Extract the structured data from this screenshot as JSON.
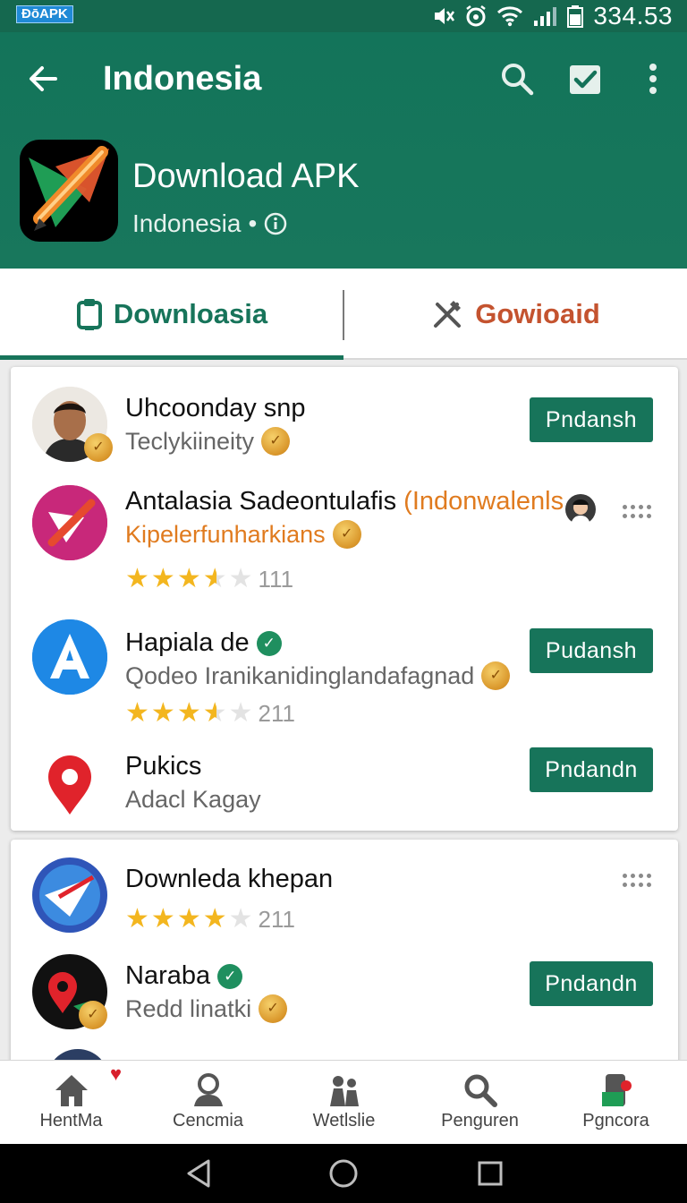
{
  "status_bar": {
    "badge": "ÐōAPK",
    "time": "334.53"
  },
  "header": {
    "title": "Indonesia",
    "app_name": "Download APK",
    "app_subtitle": "Indonesia",
    "app_subtitle_sep": "•"
  },
  "tabs": [
    {
      "label": "Downloasia",
      "active": true
    },
    {
      "label": "Gowioaid",
      "active": false
    }
  ],
  "list": [
    {
      "title": "Uhcoonday snp",
      "subtitle": "Teclykiineity",
      "button": "Pndansh"
    },
    {
      "title": "Antalasia Sadeontulafis",
      "title_accent": "(Indonwalenls",
      "subtitle": "Kipelerfunharkians",
      "rating": 3.5,
      "rating_count": "111"
    },
    {
      "title": "Hapiala de",
      "subtitle": "Qodeo Iranikanidinglandafagnad",
      "rating": 3.5,
      "rating_count": "211",
      "button": "Pudansh"
    },
    {
      "title": "Pukics",
      "subtitle": "Adacl Kagay",
      "button": "Pndandn"
    },
    {
      "title": "Downleda khepan",
      "rating": 4,
      "rating_count": "211"
    },
    {
      "title": "Naraba",
      "subtitle": "Redd linatki",
      "button": "Pndandn"
    }
  ],
  "bottom_nav": [
    {
      "label": "HentMa",
      "icon": "home-icon"
    },
    {
      "label": "Cencmia",
      "icon": "person-icon"
    },
    {
      "label": "Wetlslie",
      "icon": "people-icon"
    },
    {
      "label": "Penguren",
      "icon": "search-icon"
    },
    {
      "label": "Pgncora",
      "icon": "store-icon"
    }
  ],
  "colors": {
    "primary": "#17745a",
    "accent": "#c4532f",
    "star": "#f3b61f"
  }
}
